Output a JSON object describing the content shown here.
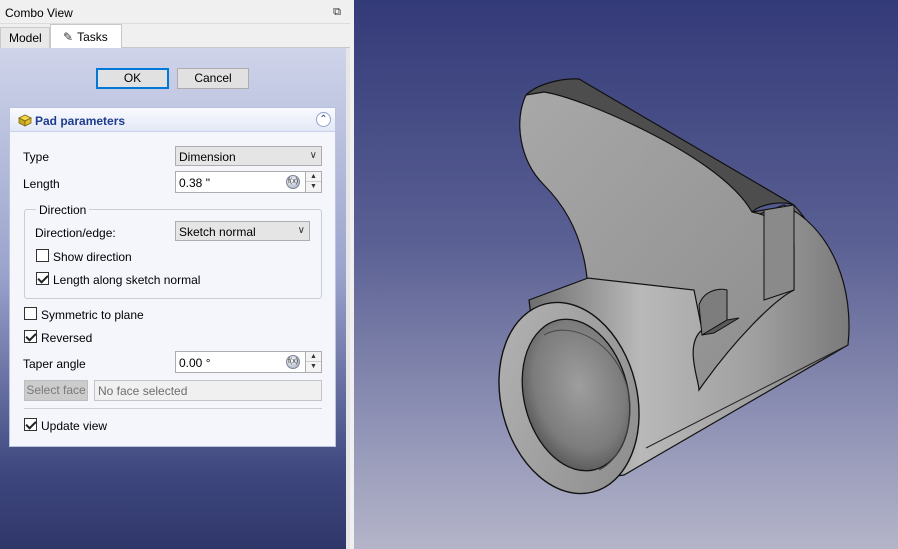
{
  "combo_view": {
    "title": "Combo View",
    "float_icon": "float-window-icon",
    "tabs": [
      {
        "label": "Model",
        "active": false
      },
      {
        "label": "Tasks",
        "active": true,
        "icon": "pencil-icon"
      }
    ]
  },
  "dialog": {
    "ok_label": "OK",
    "cancel_label": "Cancel"
  },
  "pad_parameters": {
    "title": "Pad parameters",
    "icon": "pad-icon",
    "type_label": "Type",
    "type_value": "Dimension",
    "length_label": "Length",
    "length_value": "0.38 \"",
    "direction": {
      "group_title": "Direction",
      "edge_label": "Direction/edge:",
      "edge_value": "Sketch normal",
      "show_direction_label": "Show direction",
      "show_direction_checked": false,
      "along_normal_label": "Length along sketch normal",
      "along_normal_checked": true
    },
    "symmetric_label": "Symmetric to plane",
    "symmetric_checked": false,
    "reversed_label": "Reversed",
    "reversed_checked": true,
    "taper_label": "Taper angle",
    "taper_value": "0.00 °",
    "select_face_label": "Select face",
    "face_field_value": "No face selected",
    "update_view_label": "Update view",
    "update_view_checked": true
  },
  "colors": {
    "panel_title": "#1d3c8c",
    "model_gray": "#9a9a9a",
    "view_top": "#333a78",
    "view_bottom": "#b4b5c9"
  }
}
